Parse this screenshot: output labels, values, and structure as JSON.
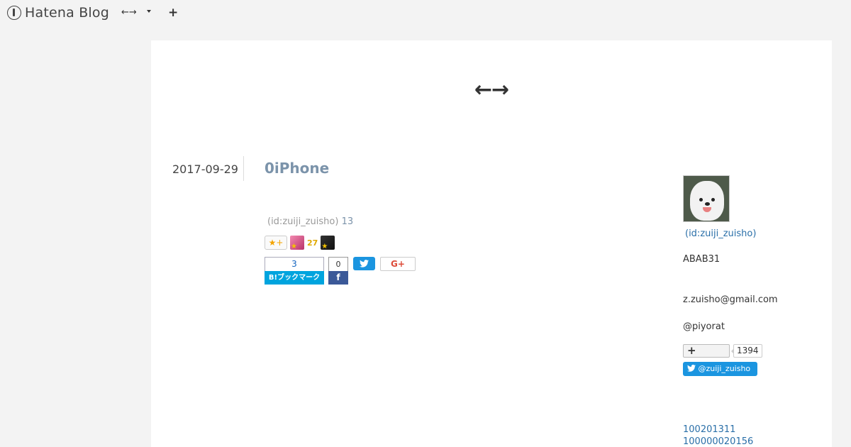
{
  "header": {
    "logo_text": "Hatena Blog",
    "blog_menu_label": "←→",
    "add_label": "+"
  },
  "blog": {
    "title": "←→"
  },
  "entry": {
    "date": "2017-09-29",
    "title": "0iPhone",
    "author": "(id:zuiji_zuisho)",
    "comment_count": "13",
    "star_add_label": "★+",
    "star_count": "27",
    "hatena_bookmark": {
      "count": "3",
      "label": "B!ブックマーク"
    },
    "facebook": {
      "count": "0",
      "label": "f"
    },
    "twitter_label": "",
    "gplus_label": "G+"
  },
  "sidebar": {
    "profile_id": "(id:zuiji_zuisho)",
    "profile_text": "ABAB31",
    "email": "z.zuisho@gmail.com",
    "handle": "@piyorat",
    "follow_label": "+",
    "follower_count": "1394",
    "twitter_follow_label": "@zuiji_zuisho",
    "links": [
      "100201311",
      "100000020156"
    ]
  },
  "colors": {
    "background": "#f3f3f3",
    "content_bg": "#ffffff",
    "entry_title": "#7b93aa",
    "link": "#2a6fa8",
    "hatena_blue": "#00a4de",
    "facebook_blue": "#3b5998",
    "twitter_blue": "#1b95e0"
  },
  "icons": [
    "hatena-logo-icon",
    "caret-down-icon",
    "plus-icon",
    "star-icon",
    "twitter-icon",
    "facebook-icon",
    "gplus-icon",
    "avatar-dog-icon"
  ]
}
